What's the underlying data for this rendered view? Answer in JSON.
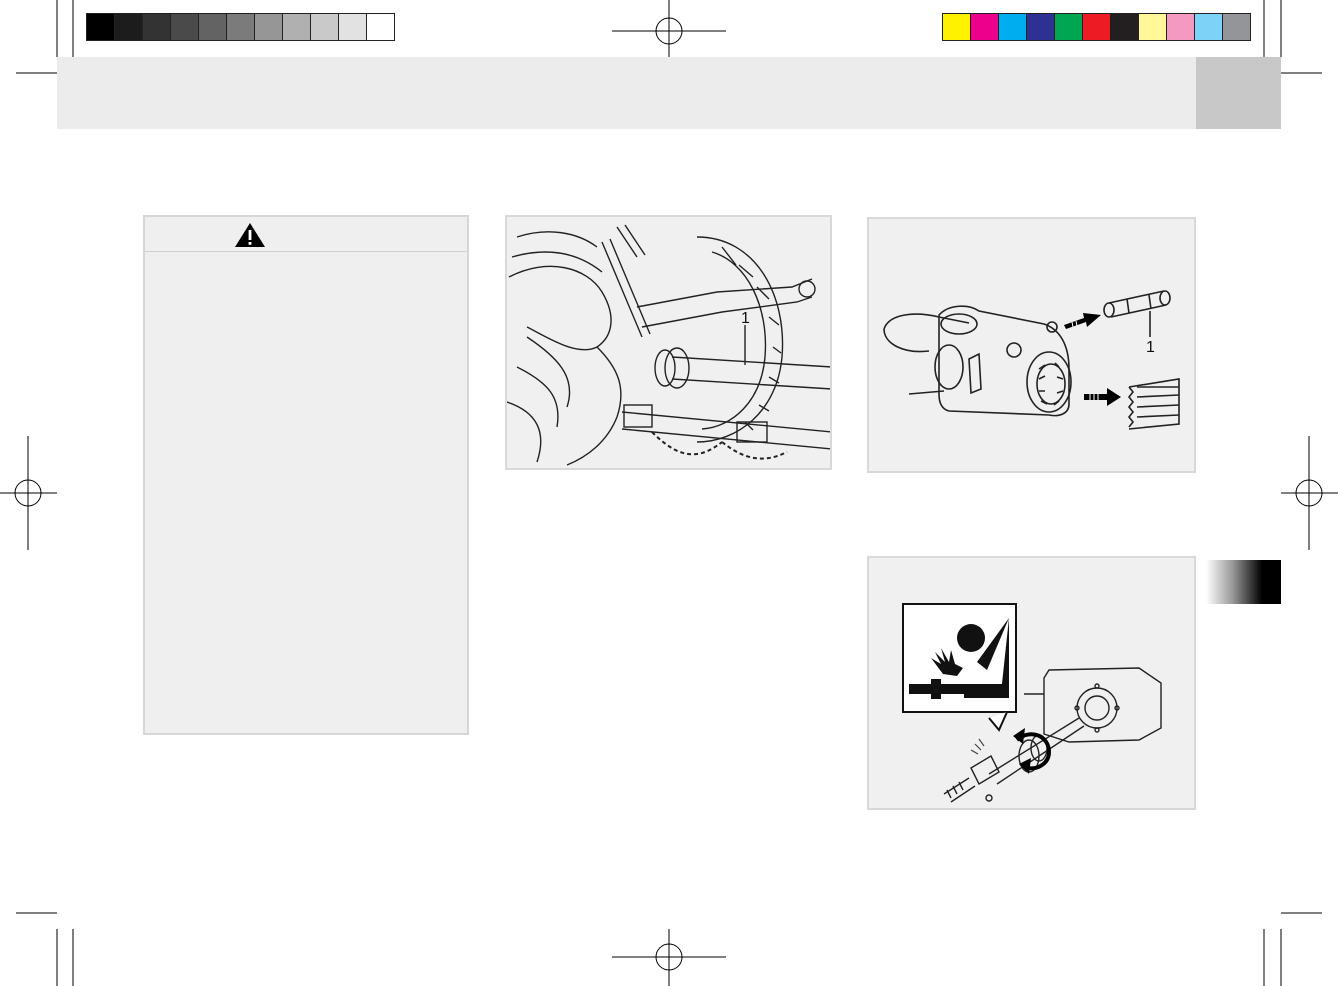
{
  "color_bar_left": [
    "#000000",
    "#1c1c1c",
    "#333333",
    "#4a4a4a",
    "#636363",
    "#7b7b7b",
    "#969696",
    "#b0b0b0",
    "#c9c9c9",
    "#e2e2e2",
    "#ffffff"
  ],
  "color_bar_right": [
    "#fff200",
    "#ec008c",
    "#00aeef",
    "#2e3192",
    "#00a651",
    "#ed1c24",
    "#231f20",
    "#fff799",
    "#f49ac1",
    "#7dd3f7",
    "#939598"
  ],
  "warning": {
    "icon": "warning-triangle-icon"
  },
  "figure_pto_shaft": {
    "callout": "1"
  },
  "figure_pto_yoke": {
    "callout": "1"
  },
  "figure_pto_hazard": {
    "icon": "entanglement-hazard-icon"
  }
}
